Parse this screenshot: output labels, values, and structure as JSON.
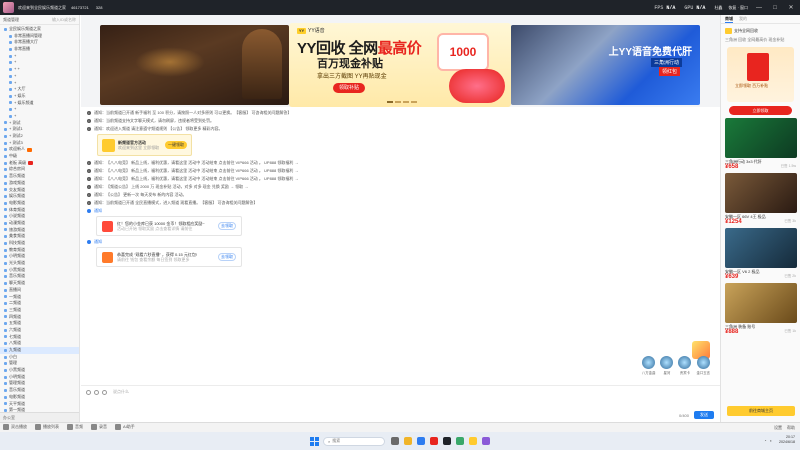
{
  "titlebar": {
    "title": "欢迎来到全民娱乐频道之家",
    "channel_id": "46173721",
    "online": "328",
    "fps_label": "FPS",
    "fps_value": "N/A",
    "gpu_label": "GPU",
    "gpu_value": "N/A",
    "user": "杜鑫",
    "right_text": "恢复 · 窗口",
    "minimize": "—",
    "maximize": "□",
    "close": "✕"
  },
  "sidebar": {
    "header": "频道管理",
    "search_placeholder": "输入ID或名称",
    "rows": [
      {
        "label": "全民娱乐频道之家",
        "indent": false,
        "badge": ""
      },
      {
        "label": "非常直播间管理",
        "indent": true,
        "badge": ""
      },
      {
        "label": "非常直播大厅",
        "indent": true,
        "badge": ""
      },
      {
        "label": "非常直播",
        "indent": true,
        "badge": ""
      },
      {
        "label": "+",
        "indent": true,
        "badge": ""
      },
      {
        "label": "+",
        "indent": true,
        "badge": ""
      },
      {
        "label": "+ +",
        "indent": true,
        "badge": ""
      },
      {
        "label": "+",
        "indent": true,
        "badge": ""
      },
      {
        "label": "+",
        "indent": true,
        "badge": ""
      },
      {
        "label": "+ 大厅",
        "indent": true,
        "badge": ""
      },
      {
        "label": "+ 娱乐",
        "indent": true,
        "badge": ""
      },
      {
        "label": "+ 娱乐频道",
        "indent": true,
        "badge": ""
      },
      {
        "label": "+",
        "indent": true,
        "badge": ""
      },
      {
        "label": "+",
        "indent": true,
        "badge": ""
      },
      {
        "label": "+ 测试",
        "indent": false,
        "badge": ""
      },
      {
        "label": "+ 测试1",
        "indent": false,
        "badge": ""
      },
      {
        "label": "+ 测试2",
        "indent": false,
        "badge": ""
      },
      {
        "label": "+ 测试3",
        "indent": false,
        "badge": ""
      },
      {
        "label": "欢迎新人",
        "indent": false,
        "badge": "#ff6a00"
      },
      {
        "label": "中级",
        "indent": false,
        "badge": ""
      },
      {
        "label": "老板 高级",
        "indent": false,
        "badge": "#e8251f"
      },
      {
        "label": "综合房间",
        "indent": false,
        "badge": ""
      },
      {
        "label": "音乐频道",
        "indent": false,
        "badge": ""
      },
      {
        "label": "游戏频道",
        "indent": false,
        "badge": ""
      },
      {
        "label": "交友频道",
        "indent": false,
        "badge": ""
      },
      {
        "label": "娱乐频道",
        "indent": false,
        "badge": ""
      },
      {
        "label": "电影频道",
        "indent": false,
        "badge": ""
      },
      {
        "label": "体育频道",
        "indent": false,
        "badge": ""
      },
      {
        "label": "小说频道",
        "indent": false,
        "badge": ""
      },
      {
        "label": "动漫频道",
        "indent": false,
        "badge": ""
      },
      {
        "label": "旅游频道",
        "indent": false,
        "badge": ""
      },
      {
        "label": "美食频道",
        "indent": false,
        "badge": ""
      },
      {
        "label": "科技频道",
        "indent": false,
        "badge": ""
      },
      {
        "label": "教育频道",
        "indent": false,
        "badge": ""
      },
      {
        "label": "小明频道",
        "indent": false,
        "badge": ""
      },
      {
        "label": "光头频道",
        "indent": false,
        "badge": ""
      },
      {
        "label": "小黑频道",
        "indent": false,
        "badge": ""
      },
      {
        "label": "音乐频道",
        "indent": false,
        "badge": ""
      },
      {
        "label": "聊天频道",
        "indent": false,
        "badge": ""
      },
      {
        "label": "直播间",
        "indent": false,
        "badge": ""
      },
      {
        "label": "一频道",
        "indent": false,
        "badge": ""
      },
      {
        "label": "二频道",
        "indent": false,
        "badge": ""
      },
      {
        "label": "三频道",
        "indent": false,
        "badge": ""
      },
      {
        "label": "四频道",
        "indent": false,
        "badge": ""
      },
      {
        "label": "五频道",
        "indent": false,
        "badge": ""
      },
      {
        "label": "六频道",
        "indent": false,
        "badge": ""
      },
      {
        "label": "七频道",
        "indent": false,
        "badge": ""
      },
      {
        "label": "八频道",
        "indent": false,
        "badge": ""
      },
      {
        "label": "九频道",
        "indent": false,
        "badge": ""
      },
      {
        "label": "小白",
        "indent": false,
        "badge": ""
      },
      {
        "label": "管理",
        "indent": false,
        "badge": ""
      },
      {
        "label": "小黑频道",
        "indent": false,
        "badge": ""
      },
      {
        "label": "小明频道",
        "indent": false,
        "badge": ""
      },
      {
        "label": "管理频道",
        "indent": false,
        "badge": ""
      },
      {
        "label": "音乐频道",
        "indent": false,
        "badge": ""
      },
      {
        "label": "电影频道",
        "indent": false,
        "badge": ""
      },
      {
        "label": "天平频道",
        "indent": false,
        "badge": ""
      },
      {
        "label": "第一频道",
        "indent": false,
        "badge": ""
      },
      {
        "label": "先锋频道",
        "indent": false,
        "badge": ""
      }
    ],
    "bottom": "办公室"
  },
  "banner": {
    "brand": "YY语音",
    "headline_part1": "YY回收 全网",
    "headline_hl": "最高价",
    "subline": "百万现金补贴",
    "tagline": "拿出三方截图 YY再贴现金",
    "cta": "领取补贴",
    "coin": "1000",
    "right_text": "上YY语音免费代肝",
    "right_sub": "三角洲行动",
    "right_badge": "领红包"
  },
  "chat": {
    "messages": [
      {
        "text": "通知：当前频道已开通 新手福利 至 100 积分，请按照一人对多原则 可以更换。【客服】 可咨询相关问题解答】"
      },
      {
        "text": "通知：当前频道支持文字聊天模式，请勿刷屏，违规者将受到处罚。"
      },
      {
        "text": "通知：欢迎进入频道 请注意遵守频道规则 【公告】 领取更多 精彩内容。"
      }
    ],
    "card": {
      "title": "新频道官方活动",
      "sub": "欢迎来到这里 立即领取",
      "button": "一键领取"
    },
    "messages2": [
      {
        "text": "通知：【八八电竞】 新品上线，福利优惠，请看这里 活动中 活动结束 点击前往 VIP666 活动 。 UP888 领取福利 →"
      },
      {
        "text": "通知：【八八电竞】 新品上线，福利优惠，请看这里 活动中 活动结束 点击前往 VIP666 活动 。 UP888 领取福利 →"
      },
      {
        "text": "通知：【八八电竞】 新品上线，福利优惠，请看这里 活动中 活动结束 点击前往 VIP666 活动 。 UP888 领取福利 →"
      },
      {
        "text": "通知：【频道公告】 上线 2000 万 现金补贴 活动，对多 对多 现金 兑换 奖励 → 领取 →"
      },
      {
        "text": "通知：【公告】 更新一次 每天发布 新的内容 活动。"
      },
      {
        "text": "通知：当前频道已开通 全民直播模式，进入频道 观看直播。【客服】 可咨询相关问题解答】"
      }
    ],
    "notice_label": "通知",
    "notices": [
      {
        "title": "红！您的小金库已获 10000 金币！领取相应奖励~",
        "sub": "活动已开始 领取奖励 点击查看详情 请前往",
        "button": "去领取"
      },
      {
        "title": "恭喜完成 “观看六秒直播” ，获得 0.15 元红包!",
        "sub": "请前往 钱包 查看余额 每日签到 领取更多",
        "button": "去领取"
      }
    ]
  },
  "gifts": [
    {
      "label": "八方金曲"
    },
    {
      "label": "星河"
    },
    {
      "label": "贵宾卡"
    },
    {
      "label": "金口玉言"
    }
  ],
  "input": {
    "placeholder": "说点什么",
    "send": "发送",
    "count": "0/400"
  },
  "right_panel": {
    "tab_active": "商城",
    "tab_inactive": "我的",
    "head": "支持全网回收 ",
    "line1": "三角洲 回收 全网最高价 现金补贴",
    "red_text": "立即领取 百万补贴",
    "red_button": "立即领取",
    "products": [
      {
        "title": "三角洲行动 3x3 代肝",
        "price": "¥658",
        "sold": "已售 1.5w",
        "c1": "#1a7a3a",
        "c2": "#0d3a22"
      },
      {
        "title": "安徽一区 66V 4王 极品",
        "price": "¥1254",
        "sold": "已售 3k",
        "c1": "#7a5a3a",
        "c2": "#2a1a12"
      },
      {
        "title": "安徽一区 V6 2 极品",
        "price": "¥639",
        "sold": "已售 2k",
        "c1": "#3a6a8a",
        "c2": "#152a3a"
      },
      {
        "title": "三角洲 装备 账号",
        "price": "¥888",
        "sold": "已售 1k",
        "c1": "#c9a35a",
        "c2": "#6a4a1a"
      }
    ],
    "bottom_button": "前往商城主页"
  },
  "statusbar": {
    "items": [
      "双击播放",
      "播放列表",
      "音频",
      "录音",
      "AI助手"
    ],
    "right": [
      "设置",
      "帮助"
    ]
  },
  "taskbar": {
    "search_placeholder": "搜索",
    "time": "20:17",
    "date": "2024/6/18"
  }
}
